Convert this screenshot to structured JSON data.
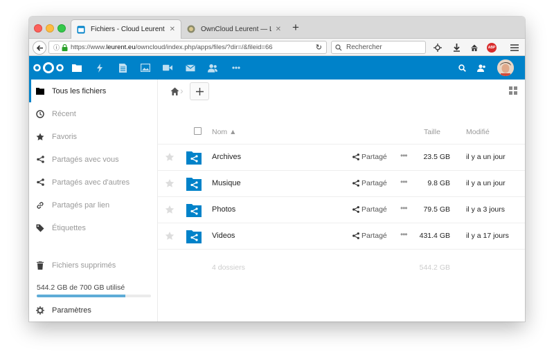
{
  "browser": {
    "tabs": [
      {
        "title": "Fichiers - Cloud Leurent",
        "close": "✕"
      },
      {
        "title": "OwnCloud Leurent — Leurent",
        "close": "✕"
      }
    ],
    "new_tab": "+",
    "url_plain_prefix": "https://www.",
    "url_domain": "leurent.eu",
    "url_path": "/owncloud/index.php/apps/files/?dir=/&fileid=66",
    "search_placeholder": "Rechercher",
    "adblock_label": "ABP"
  },
  "sidebar": {
    "items": [
      {
        "label": "Tous les fichiers",
        "icon": "folder-icon"
      },
      {
        "label": "Récent",
        "icon": "clock-icon"
      },
      {
        "label": "Favoris",
        "icon": "star-icon"
      },
      {
        "label": "Partagés avec vous",
        "icon": "share-icon"
      },
      {
        "label": "Partagés avec d'autres",
        "icon": "share-icon"
      },
      {
        "label": "Partagés par lien",
        "icon": "link-icon"
      },
      {
        "label": "Étiquettes",
        "icon": "tag-icon"
      }
    ],
    "trash": "Fichiers supprimés",
    "quota_label": "544.2 GB de 700 GB utilisé",
    "quota_used_fraction": 0.777,
    "settings": "Paramètres"
  },
  "files": {
    "headers": {
      "name": "Nom ▲",
      "size": "Taille",
      "modified": "Modifié"
    },
    "rows": [
      {
        "name": "Archives",
        "share": "Partagé",
        "size": "23.5 GB",
        "modified": "il y a un jour"
      },
      {
        "name": "Musique",
        "share": "Partagé",
        "size": "9.8 GB",
        "modified": "il y a un jour"
      },
      {
        "name": "Photos",
        "share": "Partagé",
        "size": "79.5 GB",
        "modified": "il y a 3 jours"
      },
      {
        "name": "Videos",
        "share": "Partagé",
        "size": "431.4 GB",
        "modified": "il y a 17 jours"
      }
    ],
    "summary": {
      "dirs": "4 dossiers",
      "size": "544.2 GB"
    },
    "more": "•••"
  },
  "colors": {
    "brand": "#0082c9",
    "folder": "#0082c9"
  }
}
